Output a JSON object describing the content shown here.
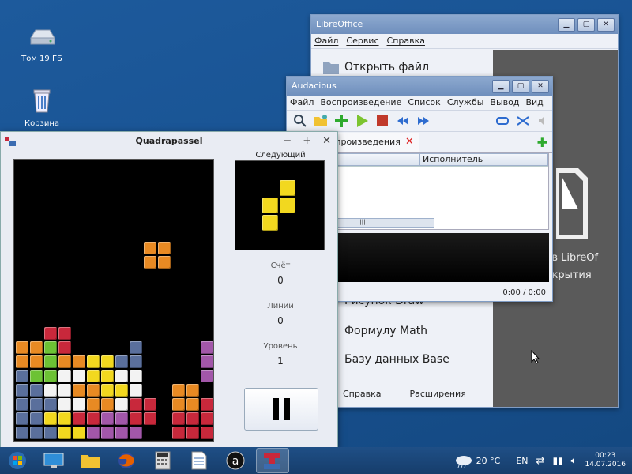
{
  "desktop": {
    "icons": [
      {
        "label": "Том 19 ГБ",
        "icon": "drive-icon"
      },
      {
        "label": "Корзина",
        "icon": "trash-icon"
      }
    ]
  },
  "libreoffice": {
    "title": "LibreOffice",
    "menu": [
      "Файл",
      "Сервис",
      "Справка"
    ],
    "entries": [
      "Открыть файл",
      "Рисунок Draw",
      "Формулу Math",
      "Базу данных Base"
    ],
    "footer": [
      "Справка",
      "Расширения"
    ],
    "right_text": [
      "ать в LibreOf",
      "я открытия"
    ]
  },
  "audacious": {
    "title": "Audacious",
    "menu": [
      "Файл",
      "Воспроизведение",
      "Список",
      "Службы",
      "Вывод",
      "Вид"
    ],
    "tab_label": "исок воспроизведения",
    "column_artist": "Исполнитель",
    "time": "0:00 / 0:00"
  },
  "quadrapassel": {
    "title": "Quadrapassel",
    "next_label": "Следующий",
    "score_label": "Счёт",
    "score": "0",
    "lines_label": "Линии",
    "lines": "0",
    "level_label": "Уровень",
    "level": "1",
    "colors": {
      "orange": "#e88a23",
      "red": "#c8283b",
      "green": "#6cc234",
      "yellow": "#f2d81f",
      "white": "#f3f3f3",
      "blue": "#3b6cb1",
      "purple": "#a257a9",
      "slate": "#5a6f9c"
    }
  },
  "taskbar": {
    "weather": "20 °C",
    "lang": "EN",
    "time": "00:23",
    "date": "14.07.2016"
  }
}
